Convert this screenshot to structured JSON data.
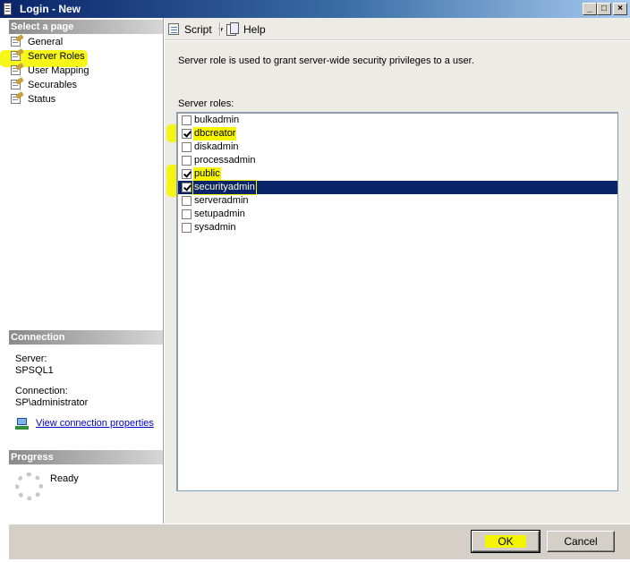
{
  "window": {
    "title": "Login - New",
    "controls": {
      "minimize": "_",
      "maximize": "□",
      "close": "×"
    }
  },
  "sidebar": {
    "header": "Select a page",
    "items": [
      {
        "label": "General",
        "icon": "page-wrench-icon"
      },
      {
        "label": "Server Roles",
        "icon": "page-wrench-icon",
        "highlighted": true
      },
      {
        "label": "User Mapping",
        "icon": "page-wrench-icon"
      },
      {
        "label": "Securables",
        "icon": "page-wrench-icon"
      },
      {
        "label": "Status",
        "icon": "page-wrench-icon"
      }
    ]
  },
  "connection": {
    "header": "Connection",
    "server_label": "Server:",
    "server_value": "SPSQL1",
    "connection_label": "Connection:",
    "connection_value": "SP\\administrator",
    "link": "View connection properties"
  },
  "progress": {
    "header": "Progress",
    "status": "Ready"
  },
  "toolbar": {
    "script_label": "Script",
    "help_label": "Help"
  },
  "main": {
    "description": "Server role is used to grant server-wide security privileges to a user.",
    "roles_label": "Server roles:",
    "roles": [
      {
        "name": "bulkadmin",
        "checked": false
      },
      {
        "name": "dbcreator",
        "checked": true,
        "highlighted": true
      },
      {
        "name": "diskadmin",
        "checked": false
      },
      {
        "name": "processadmin",
        "checked": false
      },
      {
        "name": "public",
        "checked": true,
        "highlighted": true
      },
      {
        "name": "securityadmin",
        "checked": true,
        "highlighted": true,
        "selected": true
      },
      {
        "name": "serveradmin",
        "checked": false
      },
      {
        "name": "setupadmin",
        "checked": false
      },
      {
        "name": "sysadmin",
        "checked": false
      }
    ]
  },
  "footer": {
    "ok_label": "OK",
    "cancel_label": "Cancel"
  },
  "colors": {
    "highlight": "#f5f500",
    "selection": "#0a246a",
    "title_bar": "#0a246a",
    "dialog_bg": "#ecebe6"
  }
}
